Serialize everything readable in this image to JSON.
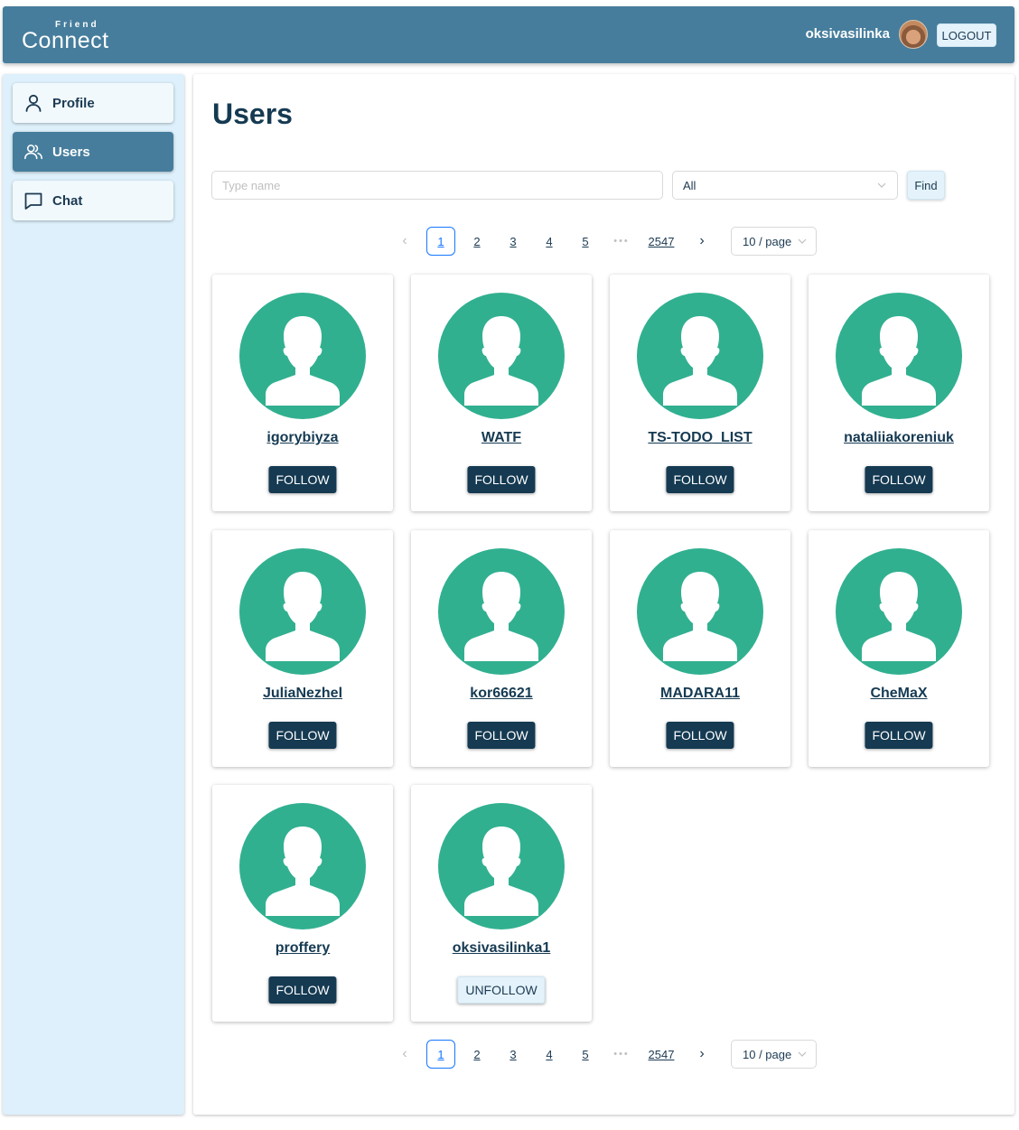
{
  "header": {
    "logo_small": "Friend",
    "logo_big": "Connect",
    "username": "oksivasilinka",
    "logout_label": "LOGOUT"
  },
  "sidebar": {
    "items": [
      {
        "label": "Profile",
        "icon": "user-icon",
        "active": false
      },
      {
        "label": "Users",
        "icon": "users-icon",
        "active": true
      },
      {
        "label": "Chat",
        "icon": "chat-icon",
        "active": false
      }
    ]
  },
  "main": {
    "title": "Users",
    "search_placeholder": "Type name",
    "search_value": "",
    "filter_value": "All",
    "find_label": "Find"
  },
  "pagination": {
    "prev": "‹",
    "next": "›",
    "pages": [
      "1",
      "2",
      "3",
      "4",
      "5"
    ],
    "current": "1",
    "dots": "•••",
    "last": "2547",
    "page_size": "10 / page"
  },
  "users": [
    {
      "name": "igorybiyza",
      "button": "FOLLOW"
    },
    {
      "name": "WATF",
      "button": "FOLLOW"
    },
    {
      "name": "TS-TODO_LIST",
      "button": "FOLLOW"
    },
    {
      "name": "nataliiakoreniuk",
      "button": "FOLLOW"
    },
    {
      "name": "JuliaNezhel",
      "button": "FOLLOW"
    },
    {
      "name": "kor66621",
      "button": "FOLLOW"
    },
    {
      "name": "MADARA11",
      "button": "FOLLOW"
    },
    {
      "name": "CheMaX",
      "button": "FOLLOW"
    },
    {
      "name": "proffery",
      "button": "FOLLOW"
    },
    {
      "name": "oksivasilinka1",
      "button": "UNFOLLOW"
    }
  ],
  "colors": {
    "header": "#467d9c",
    "sidebar_bg": "#ddf0fb",
    "avatar_green": "#31b090",
    "follow_btn": "#153a52"
  }
}
